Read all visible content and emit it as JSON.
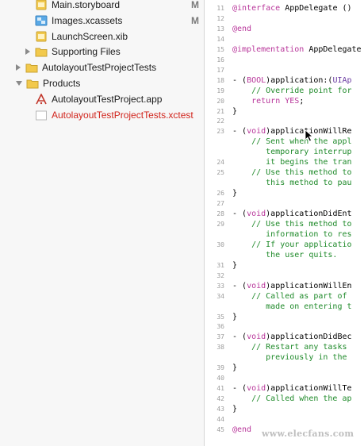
{
  "navigator": {
    "items": [
      {
        "label": "Main.storyboard",
        "status": "M"
      },
      {
        "label": "Images.xcassets",
        "status": "M"
      },
      {
        "label": "LaunchScreen.xib",
        "status": ""
      },
      {
        "label": "Supporting Files",
        "status": ""
      },
      {
        "label": "AutolayoutTestProjectTests",
        "status": ""
      },
      {
        "label": "Products",
        "status": ""
      },
      {
        "label": "AutolayoutTestProject.app",
        "status": ""
      },
      {
        "label": "AutolayoutTestProjectTests.xctest",
        "status": ""
      }
    ]
  },
  "editor": {
    "lines": [
      {
        "n": "11",
        "parts": [
          {
            "t": "@interface",
            "c": "kw"
          },
          {
            "t": " AppDelegate ()",
            "c": ""
          }
        ]
      },
      {
        "n": "12",
        "parts": []
      },
      {
        "n": "13",
        "parts": [
          {
            "t": "@end",
            "c": "kw"
          }
        ]
      },
      {
        "n": "14",
        "parts": []
      },
      {
        "n": "15",
        "parts": [
          {
            "t": "@implementation",
            "c": "kw"
          },
          {
            "t": " AppDelegate",
            "c": ""
          }
        ]
      },
      {
        "n": "16",
        "parts": []
      },
      {
        "n": "17",
        "parts": []
      },
      {
        "n": "18",
        "parts": [
          {
            "t": "- (",
            "c": ""
          },
          {
            "t": "BOOL",
            "c": "kw"
          },
          {
            "t": ")application:(",
            "c": ""
          },
          {
            "t": "UIAp",
            "c": "cls"
          }
        ]
      },
      {
        "n": "19",
        "parts": [
          {
            "t": "    // Override point for",
            "c": "cm"
          }
        ]
      },
      {
        "n": "20",
        "parts": [
          {
            "t": "    ",
            "c": ""
          },
          {
            "t": "return",
            "c": "kw"
          },
          {
            "t": " ",
            "c": ""
          },
          {
            "t": "YES",
            "c": "kw"
          },
          {
            "t": ";",
            "c": ""
          }
        ]
      },
      {
        "n": "21",
        "parts": [
          {
            "t": "}",
            "c": ""
          }
        ]
      },
      {
        "n": "22",
        "parts": []
      },
      {
        "n": "23",
        "parts": [
          {
            "t": "- (",
            "c": ""
          },
          {
            "t": "void",
            "c": "kw"
          },
          {
            "t": ")applicationWillRe",
            "c": ""
          }
        ]
      },
      {
        "n": "",
        "parts": [
          {
            "t": "    // Sent when the appl",
            "c": "cm"
          }
        ]
      },
      {
        "n": "",
        "parts": [
          {
            "t": "       temporary interrup",
            "c": "cm"
          }
        ]
      },
      {
        "n": "24",
        "parts": [
          {
            "t": "       it begins the tran",
            "c": "cm"
          }
        ]
      },
      {
        "n": "25",
        "parts": [
          {
            "t": "    // Use this method to",
            "c": "cm"
          }
        ]
      },
      {
        "n": "",
        "parts": [
          {
            "t": "       this method to pau",
            "c": "cm"
          }
        ]
      },
      {
        "n": "26",
        "parts": [
          {
            "t": "}",
            "c": ""
          }
        ]
      },
      {
        "n": "27",
        "parts": []
      },
      {
        "n": "28",
        "parts": [
          {
            "t": "- (",
            "c": ""
          },
          {
            "t": "void",
            "c": "kw"
          },
          {
            "t": ")applicationDidEnt",
            "c": ""
          }
        ]
      },
      {
        "n": "29",
        "parts": [
          {
            "t": "    // Use this method to",
            "c": "cm"
          }
        ]
      },
      {
        "n": "",
        "parts": [
          {
            "t": "       information to res",
            "c": "cm"
          }
        ]
      },
      {
        "n": "30",
        "parts": [
          {
            "t": "    // If your applicatio",
            "c": "cm"
          }
        ]
      },
      {
        "n": "",
        "parts": [
          {
            "t": "       the user quits.",
            "c": "cm"
          }
        ]
      },
      {
        "n": "31",
        "parts": [
          {
            "t": "}",
            "c": ""
          }
        ]
      },
      {
        "n": "32",
        "parts": []
      },
      {
        "n": "33",
        "parts": [
          {
            "t": "- (",
            "c": ""
          },
          {
            "t": "void",
            "c": "kw"
          },
          {
            "t": ")applicationWillEn",
            "c": ""
          }
        ]
      },
      {
        "n": "34",
        "parts": [
          {
            "t": "    // Called as part of",
            "c": "cm"
          }
        ]
      },
      {
        "n": "",
        "parts": [
          {
            "t": "       made on entering t",
            "c": "cm"
          }
        ]
      },
      {
        "n": "35",
        "parts": [
          {
            "t": "}",
            "c": ""
          }
        ]
      },
      {
        "n": "36",
        "parts": []
      },
      {
        "n": "37",
        "parts": [
          {
            "t": "- (",
            "c": ""
          },
          {
            "t": "void",
            "c": "kw"
          },
          {
            "t": ")applicationDidBec",
            "c": ""
          }
        ]
      },
      {
        "n": "38",
        "parts": [
          {
            "t": "    // Restart any tasks",
            "c": "cm"
          }
        ]
      },
      {
        "n": "",
        "parts": [
          {
            "t": "       previously in the",
            "c": "cm"
          }
        ]
      },
      {
        "n": "39",
        "parts": [
          {
            "t": "}",
            "c": ""
          }
        ]
      },
      {
        "n": "40",
        "parts": []
      },
      {
        "n": "41",
        "parts": [
          {
            "t": "- (",
            "c": ""
          },
          {
            "t": "void",
            "c": "kw"
          },
          {
            "t": ")applicationWillTe",
            "c": ""
          }
        ]
      },
      {
        "n": "42",
        "parts": [
          {
            "t": "    // Called when the ap",
            "c": "cm"
          }
        ]
      },
      {
        "n": "43",
        "parts": [
          {
            "t": "}",
            "c": ""
          }
        ]
      },
      {
        "n": "44",
        "parts": []
      },
      {
        "n": "45",
        "parts": [
          {
            "t": "@end",
            "c": "kw"
          }
        ]
      }
    ]
  },
  "watermark": "www.elecfans.com",
  "colors": {
    "keyword": "#b8359a",
    "comment": "#1f8a2a",
    "class": "#6a3ba1",
    "error_text": "#d1241c"
  }
}
